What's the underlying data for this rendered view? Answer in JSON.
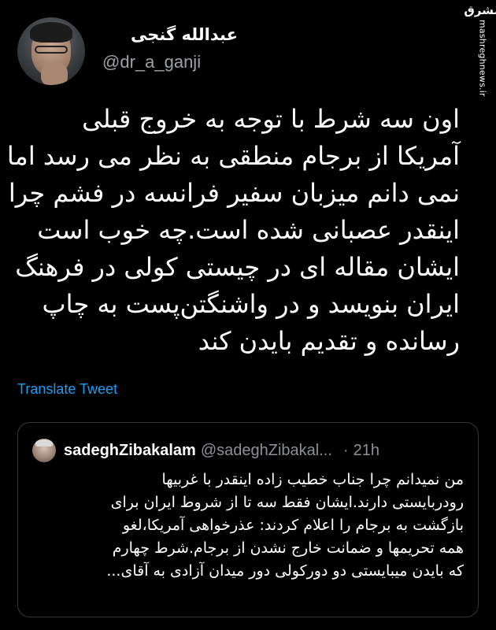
{
  "watermark": {
    "logo": "مشرق",
    "url": "mashreghnews.ir"
  },
  "author": {
    "display_name": "عبدالله گنجی",
    "handle": "@dr_a_ganji"
  },
  "tweet": {
    "lines": [
      "اون سه شرط با توجه به خروج قبلی",
      "آمریکا از برجام منطقی به نظر می رسد اما",
      "نمی دانم میزبان سفیر فرانسه در فشم چرا",
      "اینقدر عصبانی شده است.چه خوب است",
      "ایشان مقاله ای در چیستی کولی در فرهنگ",
      "ایران بنویسد و در واشنگتن‌پست به چاپ",
      "رسانده و تقدیم بایدن کند"
    ],
    "translate_label": "Translate Tweet"
  },
  "quote": {
    "name": "sadeghZibakalam",
    "handle": "@sadeghZibakal...",
    "separator": "·",
    "time": "21h",
    "lines": [
      "من نمیدانم چرا جناب خطیب زاده اینقدر با غربیها",
      "رودربایستی دارند.ایشان فقط سه تا از شروط ایران برای",
      "بازگشت به برجام را اعلام کردند: عذرخواهی آمریکا،لغو",
      "همه تحریمها و ضمانت خارج نشدن از برجام.شرط چهارم",
      "که بایدن میبایستی دو دورکولی دور میدان آزادی به آقای..."
    ]
  }
}
